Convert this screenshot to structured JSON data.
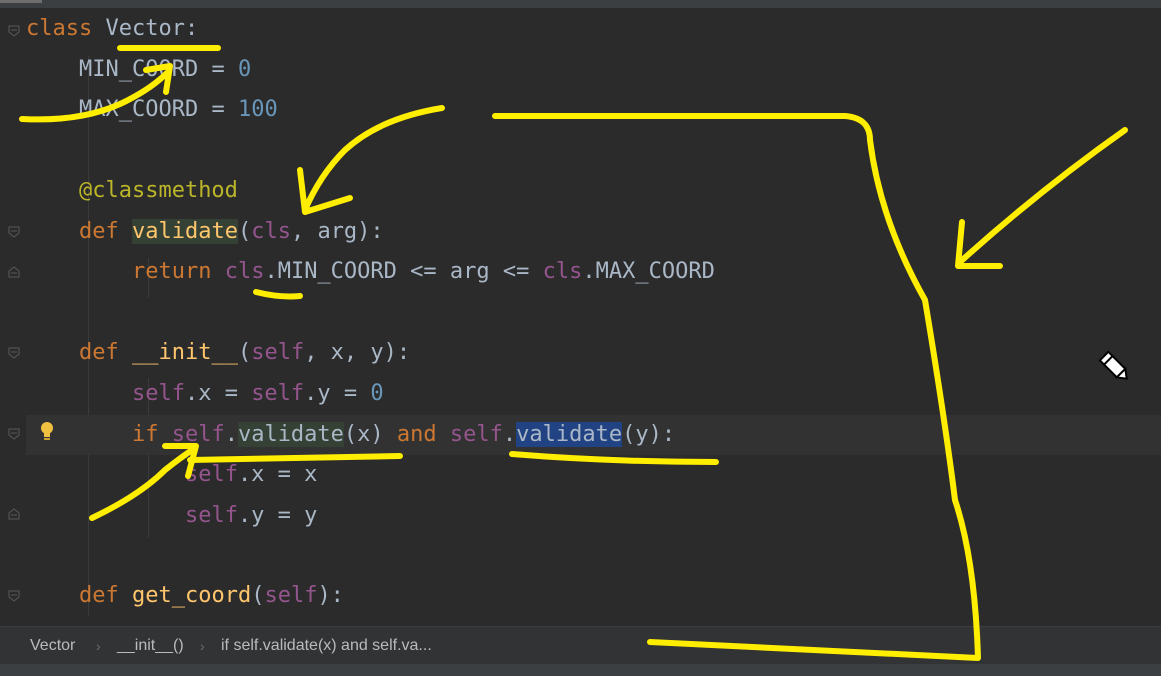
{
  "colors": {
    "background": "#2b2b2b",
    "keyword": "#cc7832",
    "number": "#6897bb",
    "decorator": "#bbb529",
    "function": "#ffc66d",
    "self_param": "#94558d",
    "default_text": "#a9b7c6",
    "usage_highlight": "#344134",
    "selection_highlight": "#214283",
    "annotation": "#ffee00"
  },
  "code": {
    "l1": {
      "kw": "class",
      "sp": " ",
      "name": "Vector",
      "colon": ":"
    },
    "l2": {
      "indent": "    ",
      "name": "MIN_COORD",
      "op": " = ",
      "num": "0"
    },
    "l3": {
      "indent": "    ",
      "name": "MAX_COORD",
      "op": " = ",
      "num": "100"
    },
    "l4": {
      "indent": "    ",
      "dec": "@classmethod"
    },
    "l5": {
      "indent": "    ",
      "kw": "def",
      "sp": " ",
      "fn": "validate",
      "open": "(",
      "cls": "cls",
      "rest": ", arg):"
    },
    "l6": {
      "indent": "        ",
      "kw": "return",
      "sp": " ",
      "cls1": "cls",
      "mid": ".MIN_COORD <= arg <= ",
      "cls2": "cls",
      "end": ".MAX_COORD"
    },
    "l7": {
      "indent": "    ",
      "kw": "def",
      "sp": " ",
      "fn": "__init__",
      "open": "(",
      "self": "self",
      "rest": ", x, y):"
    },
    "l8": {
      "indent": "        ",
      "self1": "self",
      "mid1": ".x = ",
      "self2": "self",
      "mid2": ".y = ",
      "num": "0"
    },
    "l9": {
      "indent": "        ",
      "kw": "if",
      "sp": " ",
      "self1": "self",
      "dot1": ".",
      "call1": "validate",
      "args1": "(x) ",
      "and": "and",
      "sp2": " ",
      "self2": "self",
      "dot2": ".",
      "call2": "validate",
      "args2": "(y):"
    },
    "l10": {
      "indent": "            ",
      "self": "self",
      "rest": ".x = x"
    },
    "l11": {
      "indent": "            ",
      "self": "self",
      "rest": ".y = y"
    },
    "l12": {
      "indent": "    ",
      "kw": "def",
      "sp": " ",
      "fn": "get_coord",
      "open": "(",
      "self": "self",
      "rest": "):"
    }
  },
  "breadcrumbs": {
    "items": [
      "Vector",
      "__init__()",
      "if self.validate(x) and self.va..."
    ],
    "separator": "›"
  },
  "icons": {
    "intention": "lightbulb-icon",
    "cursor": "pencil-cursor-icon",
    "fold": "fold-marker-icon"
  }
}
